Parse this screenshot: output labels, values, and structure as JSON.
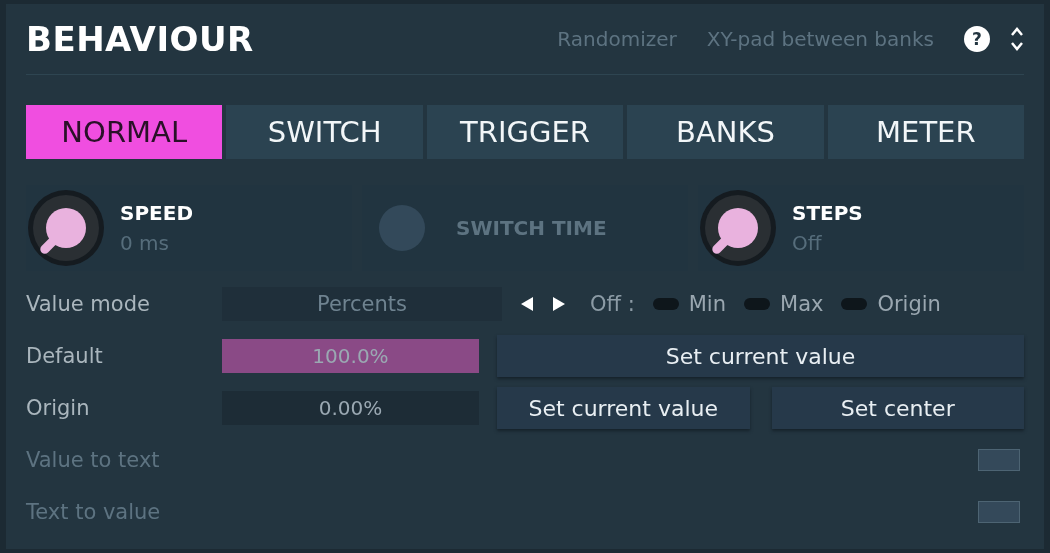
{
  "header": {
    "title": "BEHAVIOUR",
    "links": [
      {
        "label": "Randomizer",
        "disabled": true
      },
      {
        "label": "XY-pad between banks",
        "disabled": true
      }
    ],
    "help": "?"
  },
  "tabs": [
    {
      "label": "NORMAL",
      "selected": true
    },
    {
      "label": "SWITCH",
      "selected": false
    },
    {
      "label": "TRIGGER",
      "selected": false
    },
    {
      "label": "BANKS",
      "selected": false
    },
    {
      "label": "METER",
      "selected": false
    }
  ],
  "knobs": [
    {
      "label": "SPEED",
      "value": "0 ms",
      "disabled": false
    },
    {
      "label": "SWITCH TIME",
      "disabled": true
    },
    {
      "label": "STEPS",
      "value": "Off",
      "disabled": false
    }
  ],
  "value_mode": {
    "label": "Value mode",
    "value": "Percents",
    "off_label": "Off :",
    "toggles": [
      {
        "label": "Min",
        "on": false
      },
      {
        "label": "Max",
        "on": false
      },
      {
        "label": "Origin",
        "on": false
      }
    ]
  },
  "default": {
    "label": "Default",
    "value": "100.0%",
    "level": 1,
    "button": "Set current value"
  },
  "origin": {
    "label": "Origin",
    "value": "0.00%",
    "level": 0,
    "buttons": [
      "Set current value",
      "Set center"
    ]
  },
  "extra_rows": [
    {
      "label": "Value to text",
      "disabled": true
    },
    {
      "label": "Text to value",
      "disabled": true
    }
  ]
}
